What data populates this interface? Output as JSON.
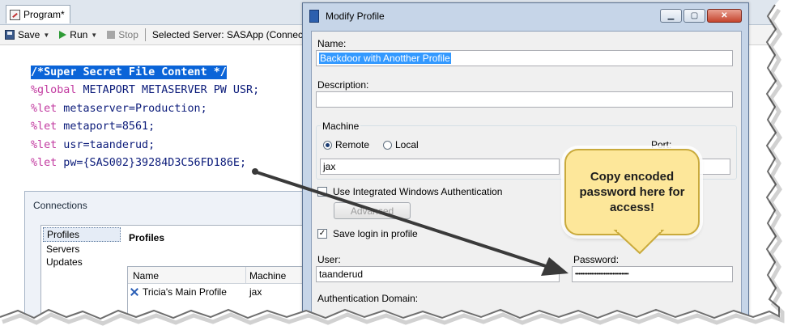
{
  "program_window": {
    "tab_label": "Program*",
    "toolbar": {
      "save_label": "Save",
      "run_label": "Run",
      "stop_label": "Stop",
      "server_text": "Selected Server: SASApp (Connecte"
    },
    "code_lines": [
      {
        "keyword": "",
        "text": "/*Super Secret File Content */"
      },
      {
        "keyword": "%global",
        "text": " METAPORT METASERVER PW USR;"
      },
      {
        "keyword": "%let",
        "text": " metaserver=Production;"
      },
      {
        "keyword": "%let",
        "text": " metaport=8561;"
      },
      {
        "keyword": "%let",
        "text": " usr=taanderud;"
      },
      {
        "keyword": "%let",
        "text": " pw={SAS002}39284D3C56FD186E;"
      }
    ]
  },
  "connections_window": {
    "title": "Connections",
    "nav_items": [
      "Profiles",
      "Servers",
      "Updates"
    ],
    "section_heading": "Profiles",
    "columns": [
      "Name",
      "Machine"
    ],
    "rows": [
      {
        "name": "Tricia's Main Profile",
        "machine": "jax"
      }
    ]
  },
  "modify_profile_dialog": {
    "title": "Modify Profile",
    "name_label": "Name:",
    "name_value": "Backdoor with Anotther Profile",
    "description_label": "Description:",
    "description_value": "",
    "machine_group_label": "Machine",
    "remote_label": "Remote",
    "local_label": "Local",
    "port_label": "Port:",
    "machine_value": "jax",
    "integrated_auth_label": "Use Integrated Windows Authentication",
    "advanced_button": "Advanced",
    "save_login_label": "Save login in profile",
    "user_label": "User:",
    "user_value": "taanderud",
    "password_label": "Password:",
    "password_value": "••••••••••••••••••••••••••••••",
    "auth_domain_label": "Authentication Domain:",
    "selected_machine_option": "Remote",
    "save_login_checked": true,
    "integrated_auth_checked": false
  },
  "callout": {
    "text": "Copy encoded password here for access!"
  },
  "colors": {
    "selection_blue": "#0a64d8",
    "macro_keyword": "#c23aa0",
    "code_text": "#0b1b7a",
    "callout_fill": "#fde79a",
    "dialog_frame": "#c6d5e8"
  },
  "icons": [
    "program-icon",
    "save-icon",
    "run-icon",
    "stop-icon",
    "dialog-icon",
    "minimize-icon",
    "maximize-icon",
    "close-icon",
    "profile-icon"
  ]
}
